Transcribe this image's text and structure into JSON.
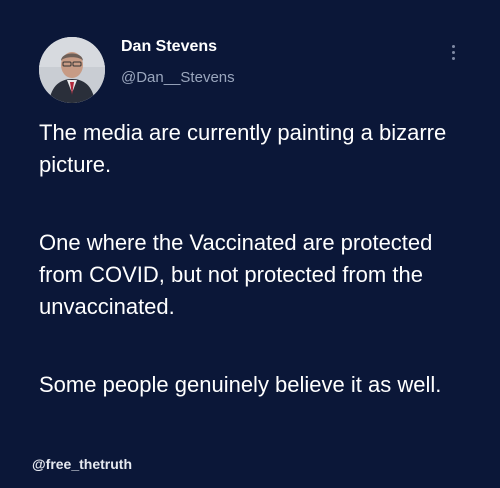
{
  "tweet": {
    "author": {
      "name": "Dan Stevens",
      "handle": "@Dan__Stevens"
    },
    "paragraphs": [
      "The media are currently painting a bizarre picture.",
      "One where the Vaccinated are protected from COVID, but not protected from the unvaccinated.",
      "Some people genuinely believe it as well."
    ],
    "menu_icon": "more-vertical-icon"
  },
  "watermark": "@free_thetruth",
  "colors": {
    "background": "#0b1738",
    "text": "#ffffff",
    "handle": "#9aa6bd"
  }
}
